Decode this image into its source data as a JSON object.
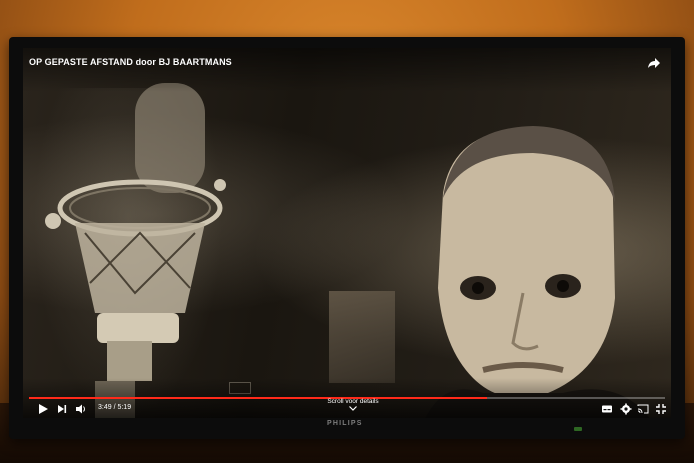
{
  "player": {
    "title": "OP GEPASTE AFSTAND door BJ BAARTMANS",
    "current_time": "3:49",
    "separator": " / ",
    "duration": "5:19",
    "progress_fraction": 0.72,
    "scroll_hint": "Scroll voor details",
    "accent_color": "#ff2a1a"
  },
  "monitor": {
    "brand": "PHILIPS"
  },
  "icons": {
    "share": "share-icon",
    "play": "play-icon",
    "next": "next-icon",
    "volume": "volume-icon",
    "subtitles": "subtitles-icon",
    "settings": "gear-icon",
    "cast": "cast-icon",
    "exit_fullscreen": "exit-fullscreen-icon",
    "scroll": "chevron-down-icon"
  }
}
